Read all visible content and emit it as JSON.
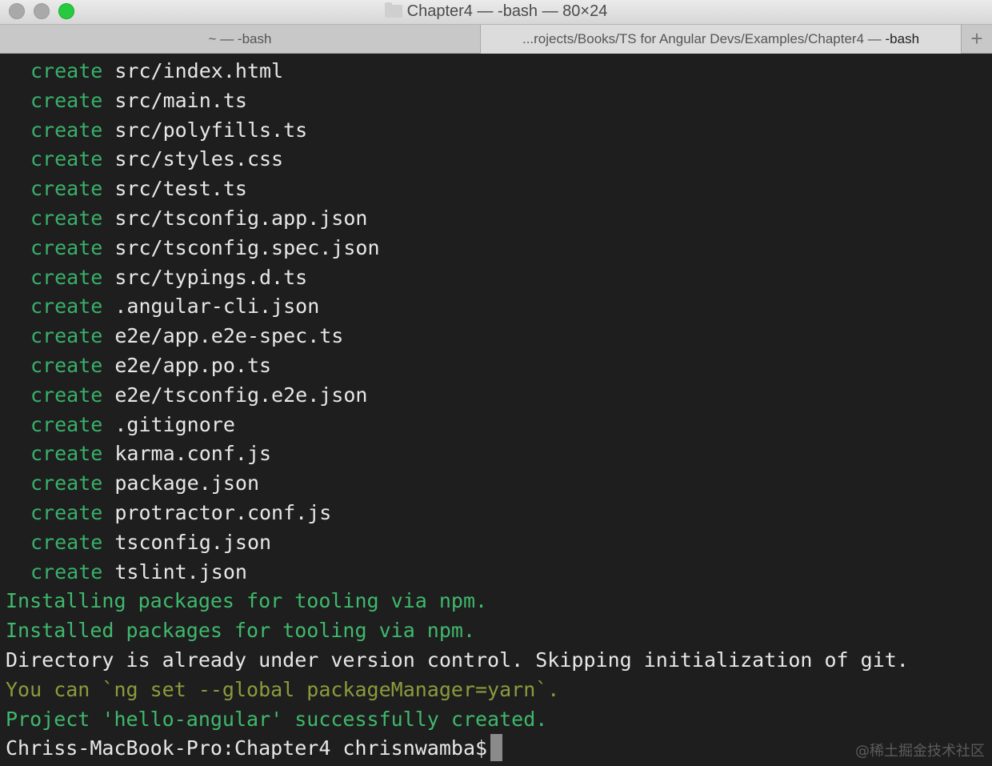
{
  "window": {
    "title": "Chapter4 — -bash — 80×24"
  },
  "tabs": [
    {
      "label": "~ — -bash",
      "active": false
    },
    {
      "label_dim": "...rojects/Books/TS for Angular Devs/Examples/Chapter4 —",
      "label": " -bash",
      "active": true
    }
  ],
  "tab_add_icon": "+",
  "terminal": {
    "create_word": "create",
    "created_files": [
      "src/index.html",
      "src/main.ts",
      "src/polyfills.ts",
      "src/styles.css",
      "src/test.ts",
      "src/tsconfig.app.json",
      "src/tsconfig.spec.json",
      "src/typings.d.ts",
      ".angular-cli.json",
      "e2e/app.e2e-spec.ts",
      "e2e/app.po.ts",
      "e2e/tsconfig.e2e.json",
      ".gitignore",
      "karma.conf.js",
      "package.json",
      "protractor.conf.js",
      "tsconfig.json",
      "tslint.json"
    ],
    "installing": "Installing packages for tooling via npm.",
    "installed": "Installed packages for tooling via npm.",
    "directory_msg": "Directory is already under version control. Skipping initialization of git.",
    "yarn_hint": "You can `ng set --global packageManager=yarn`.",
    "success": "Project 'hello-angular' successfully created.",
    "prompt": "Chriss-MacBook-Pro:Chapter4 chrisnwamba$"
  },
  "watermark": "@稀土掘金技术社区",
  "colors": {
    "terminal_bg": "#1e1e1e",
    "create_green": "#39b06a",
    "message_green": "#3fb96b",
    "hint_yellow": "#8e9a3c",
    "text": "#e8e8e8",
    "close_light": "#a9a9a9",
    "zoom_light": "#27c93f"
  }
}
